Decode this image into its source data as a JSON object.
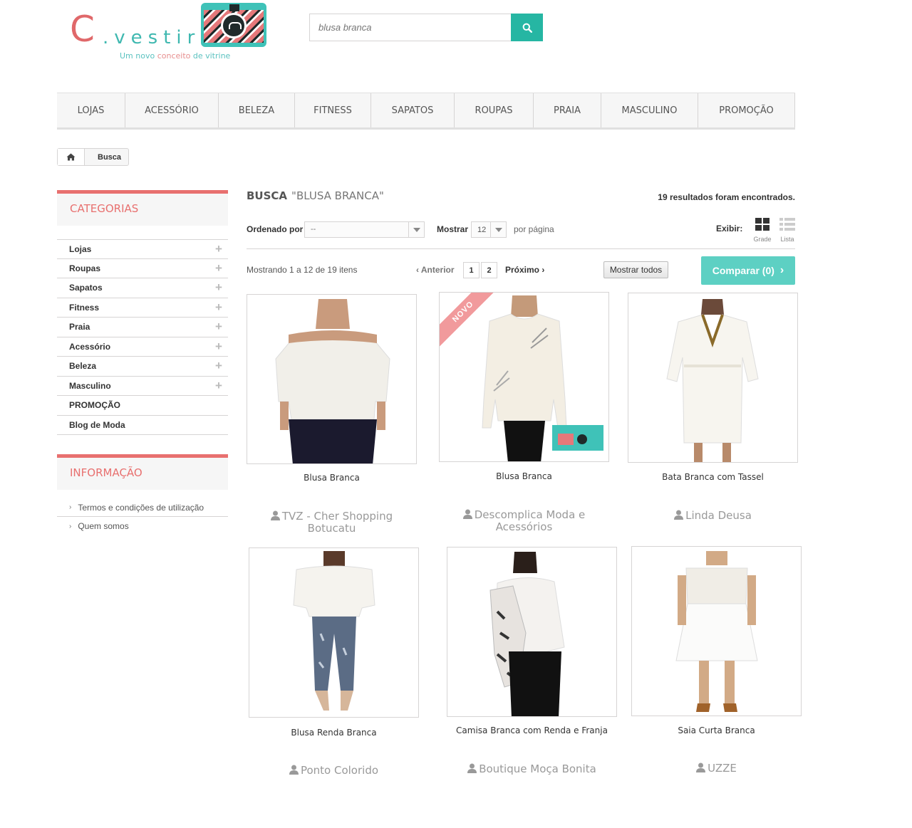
{
  "logo": {
    "mark": "C",
    "word": ".vestir",
    "tagline_a": "Um novo ",
    "tagline_b": "conceito",
    "tagline_c": " de vitrine"
  },
  "search": {
    "placeholder": "blusa branca"
  },
  "nav": [
    "LOJAS",
    "ACESSÓRIO",
    "BELEZA",
    "FITNESS",
    "SAPATOS",
    "ROUPAS",
    "PRAIA",
    "MASCULINO",
    "PROMOÇÃO"
  ],
  "breadcrumb": {
    "current": "Busca"
  },
  "sidebar": {
    "categories_title": "CATEGORIAS",
    "categories": [
      {
        "label": "Lojas",
        "expandable": true
      },
      {
        "label": "Roupas",
        "expandable": true
      },
      {
        "label": "Sapatos",
        "expandable": true
      },
      {
        "label": "Fitness",
        "expandable": true
      },
      {
        "label": "Praia",
        "expandable": true
      },
      {
        "label": "Acessório",
        "expandable": true
      },
      {
        "label": "Beleza",
        "expandable": true
      },
      {
        "label": "Masculino",
        "expandable": true
      },
      {
        "label": "PROMOÇÃO",
        "expandable": false
      },
      {
        "label": "Blog de Moda",
        "expandable": false
      }
    ],
    "info_title": "INFORMAÇÃO",
    "info_links": [
      "Termos e condições de utilização",
      "Quem somos"
    ]
  },
  "main": {
    "heading": "BUSCA",
    "query": "\"BLUSA BRANCA\"",
    "result_count": "19 resultados foram encontrados.",
    "sort_label": "Ordenado por",
    "sort_value": "--",
    "show_label": "Mostrar",
    "show_value": "12",
    "per_page": "por página",
    "view_label": "Exibir:",
    "view_grid": "Grade",
    "view_list": "Lista",
    "showing": "Mostrando 1 a 12 de 19 itens",
    "prev": "Anterior",
    "pages": [
      "1",
      "2"
    ],
    "next": "Próximo",
    "show_all": "Mostrar todos",
    "compare": "Comparar (0)"
  },
  "products": [
    {
      "name": "Blusa Branca",
      "store": "TVZ - Cher Shopping Botucatu",
      "badge": ""
    },
    {
      "name": "Blusa Branca",
      "store": "Descomplica Moda e Acessórios",
      "badge": "NOVO"
    },
    {
      "name": "Bata Branca com Tassel",
      "store": "Linda Deusa",
      "badge": ""
    },
    {
      "name": "Blusa Renda Branca",
      "store": "Ponto Colorido",
      "badge": ""
    },
    {
      "name": "Camisa Branca com Renda e Franja",
      "store": "Boutique Moça Bonita",
      "badge": ""
    },
    {
      "name": "Saia Curta Branca",
      "store": "UZZE",
      "badge": ""
    }
  ],
  "colors": {
    "accent_pink": "#e8706f",
    "accent_teal": "#26b6a3",
    "compare_teal": "#5dd0c3"
  }
}
